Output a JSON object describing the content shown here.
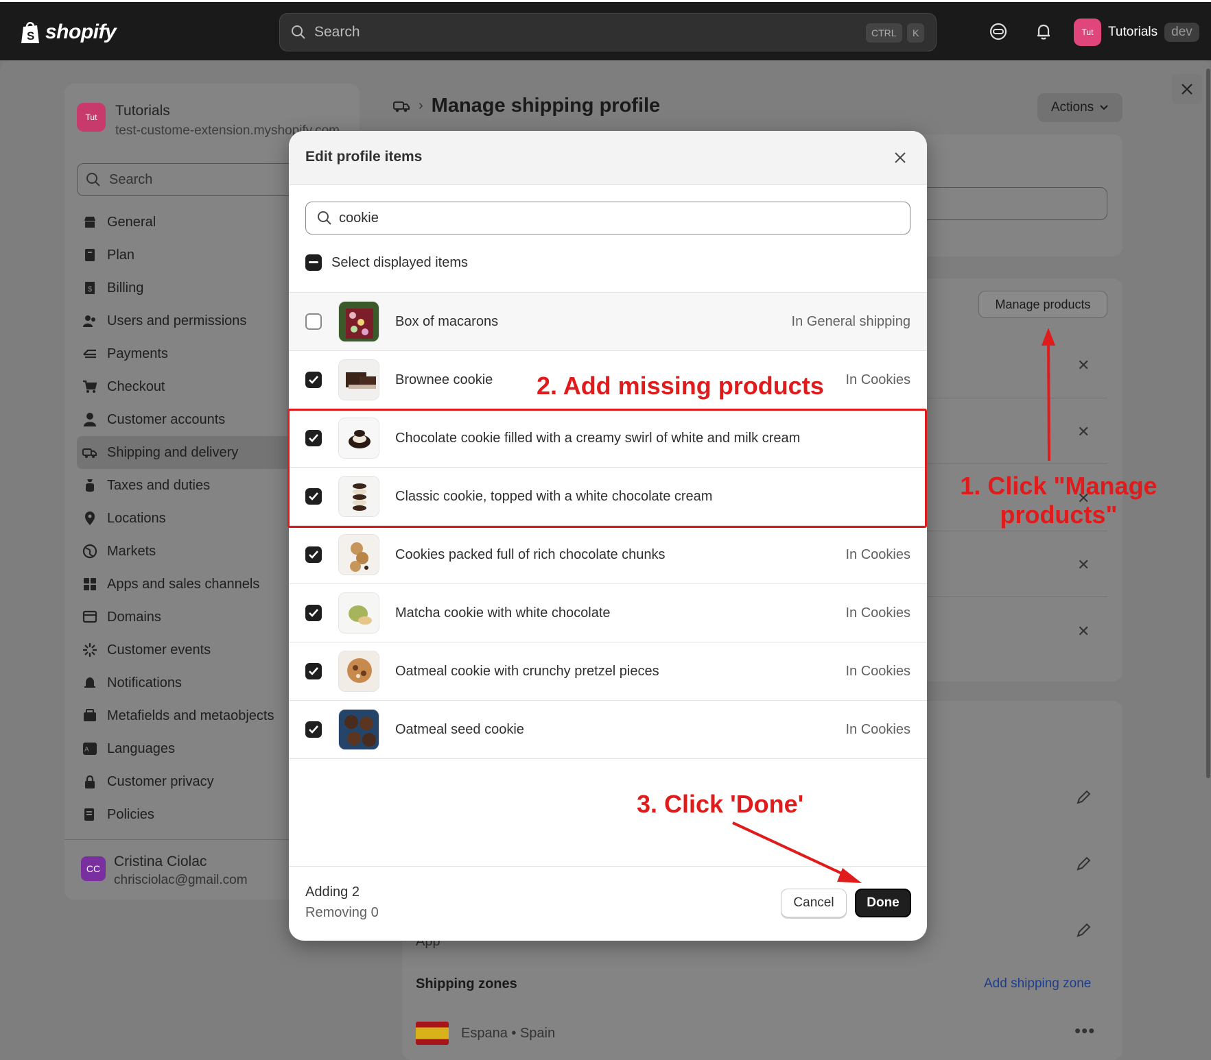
{
  "topbar": {
    "brand": "shopify",
    "search_placeholder": "Search",
    "shortcut_ctrl": "CTRL",
    "shortcut_k": "K",
    "store_avatar": "Tut",
    "store_name": "Tutorials",
    "store_badge": "dev"
  },
  "sidebar": {
    "store_avatar": "Tut",
    "store_name": "Tutorials",
    "store_domain": "test-custome-extension.myshopify.com",
    "search_placeholder": "Search",
    "items": [
      {
        "label": "General",
        "icon": "store-icon"
      },
      {
        "label": "Plan",
        "icon": "plan-icon"
      },
      {
        "label": "Billing",
        "icon": "billing-icon"
      },
      {
        "label": "Users and permissions",
        "icon": "users-icon"
      },
      {
        "label": "Payments",
        "icon": "payments-icon"
      },
      {
        "label": "Checkout",
        "icon": "cart-icon"
      },
      {
        "label": "Customer accounts",
        "icon": "person-icon"
      },
      {
        "label": "Shipping and delivery",
        "icon": "truck-icon"
      },
      {
        "label": "Taxes and duties",
        "icon": "taxes-icon"
      },
      {
        "label": "Locations",
        "icon": "location-icon"
      },
      {
        "label": "Markets",
        "icon": "globe-icon"
      },
      {
        "label": "Apps and sales channels",
        "icon": "apps-icon"
      },
      {
        "label": "Domains",
        "icon": "domains-icon"
      },
      {
        "label": "Customer events",
        "icon": "events-icon"
      },
      {
        "label": "Notifications",
        "icon": "bell-icon"
      },
      {
        "label": "Metafields and metaobjects",
        "icon": "metafields-icon"
      },
      {
        "label": "Languages",
        "icon": "languages-icon"
      },
      {
        "label": "Customer privacy",
        "icon": "lock-icon"
      },
      {
        "label": "Policies",
        "icon": "policies-icon"
      }
    ],
    "active_item": "Shipping and delivery",
    "user_initials": "CC",
    "user_name": "Cristina Ciolac",
    "user_email": "chrisciolac@gmail.com"
  },
  "main": {
    "title": "Manage shipping profile",
    "actions_label": "Actions",
    "manage_products_label": "Manage products",
    "app_label": "App",
    "shipping_zones_title": "Shipping zones",
    "add_zone_label": "Add shipping zone",
    "zone_name": "Espana • Spain"
  },
  "modal": {
    "title": "Edit profile items",
    "search_value": "cookie",
    "select_all_label": "Select displayed items",
    "items": [
      {
        "name": "Box of macarons",
        "status": "In General shipping",
        "checked": false
      },
      {
        "name": "Brownee cookie",
        "status": "In Cookies",
        "checked": true
      },
      {
        "name": "Chocolate cookie filled with a creamy swirl of white and milk cream",
        "status": "",
        "checked": true
      },
      {
        "name": "Classic cookie, topped with a white chocolate cream",
        "status": "",
        "checked": true
      },
      {
        "name": "Cookies packed full of rich chocolate chunks",
        "status": "In Cookies",
        "checked": true
      },
      {
        "name": "Matcha cookie with white chocolate",
        "status": "In Cookies",
        "checked": true
      },
      {
        "name": "Oatmeal cookie with crunchy pretzel pieces",
        "status": "In Cookies",
        "checked": true
      },
      {
        "name": "Oatmeal seed cookie",
        "status": "In Cookies",
        "checked": true
      }
    ],
    "adding_text": "Adding 2",
    "removing_text": "Removing 0",
    "cancel_label": "Cancel",
    "done_label": "Done"
  },
  "annotations": {
    "step1": "1. Click \"Manage products\"",
    "step1_line1": "1. Click \"Manage",
    "step1_line2": "products\"",
    "step2": "2. Add missing products",
    "step3": "3. Click 'Done'",
    "color": "#e01b1b"
  }
}
